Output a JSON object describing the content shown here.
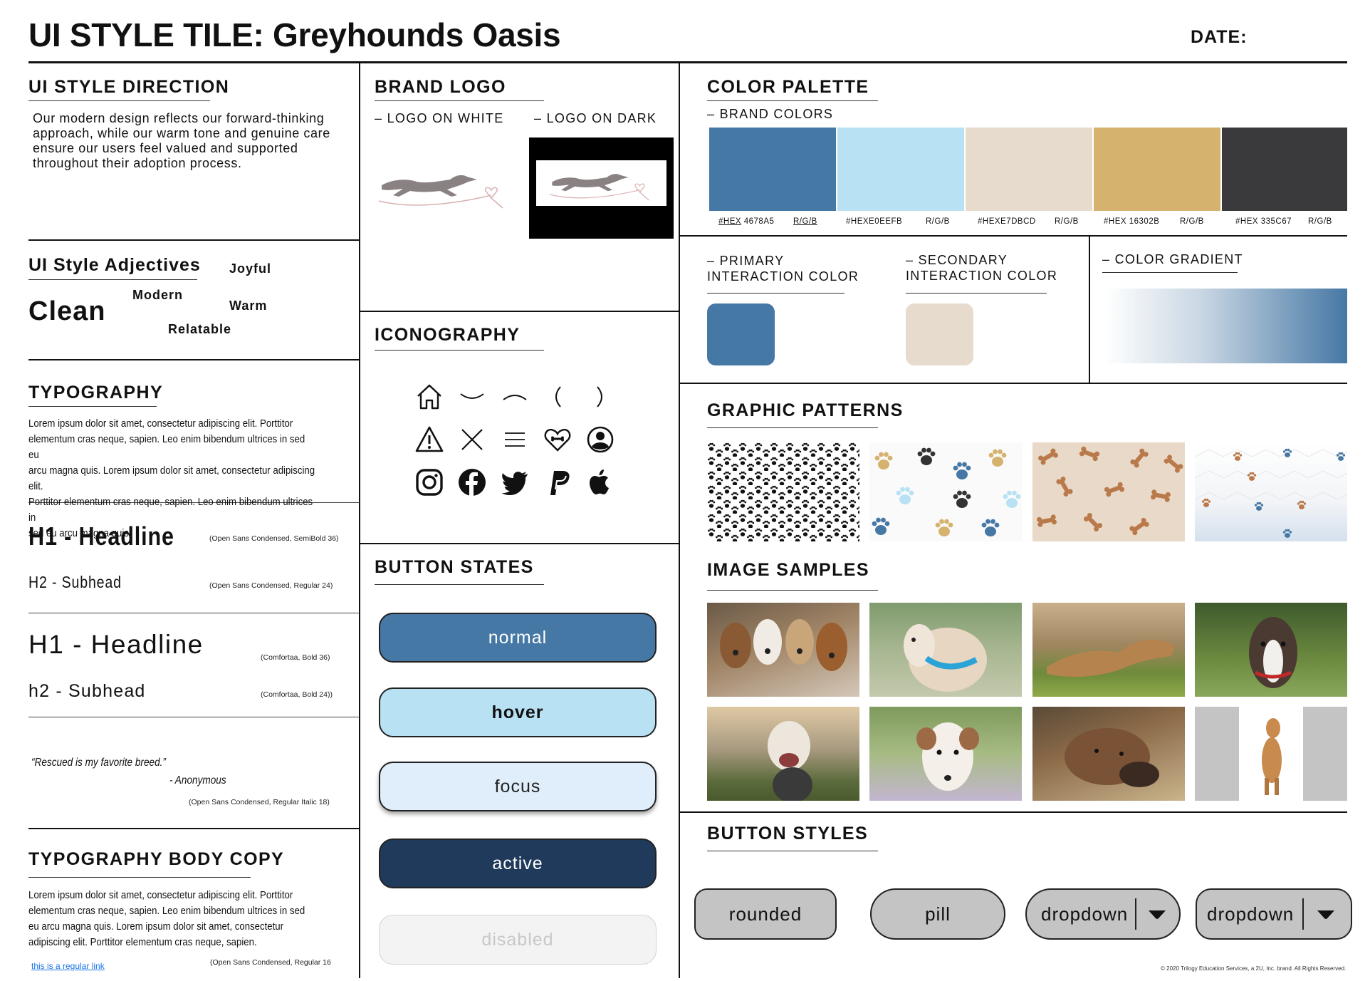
{
  "header": {
    "title": "UI STYLE TILE: Greyhounds Oasis",
    "date_label": "DATE:"
  },
  "direction": {
    "heading": "UI STYLE DIRECTION",
    "text_lines": [
      "Our modern design reflects our forward-thinking",
      "approach, while our warm tone and genuine care",
      "ensure our users feel valued and supported",
      "throughout their adoption process."
    ]
  },
  "adjectives": {
    "heading": "UI Style Adjectives",
    "words": {
      "clean": "Clean",
      "modern": "Modern",
      "joyful": "Joyful",
      "warm": "Warm",
      "relatable": "Relatable"
    }
  },
  "typography": {
    "heading": "TYPOGRAPHY",
    "lorem_lines": [
      "Lorem ipsum dolor sit amet, consectetur adipiscing elit. Porttitor",
      "elementum cras neque, sapien. Leo enim bibendum ultrices in sed eu",
      "arcu magna quis. Lorem ipsum dolor sit amet, consectetur adipiscing elit.",
      "Porttitor elementum cras neque, sapien. Leo enim bibendum ultrices in",
      "sed eu arcu magna quis."
    ],
    "h1_a": "H1 - Headline",
    "h1_a_note": "(Open Sans Condensed, SemiBold 36)",
    "h2_a": "H2 - Subhead",
    "h2_a_note": "(Open Sans Condensed, Regular 24)",
    "h1_b": "H1 - Headline",
    "h1_b_note": "(Comfortaa, Bold 36)",
    "h2_b": "h2 - Subhead",
    "h2_b_note": "(Comfortaa, Bold 24))",
    "quote": "“Rescued is my favorite breed.”",
    "quote_author": "- Anonymous",
    "quote_note": "(Open Sans Condensed, Regular Italic 18)"
  },
  "body_copy": {
    "heading": "TYPOGRAPHY BODY COPY",
    "lines": [
      "Lorem ipsum dolor sit amet, consectetur adipiscing elit. Porttitor",
      "elementum cras neque, sapien. Leo enim bibendum ultrices in sed",
      "eu arcu magna quis. Lorem ipsum dolor sit amet, consectetur",
      "adipiscing elit. Porttitor elementum cras neque, sapien."
    ],
    "link": "this is a regular link",
    "note": "(Open Sans Condensed, Regular 16"
  },
  "logo": {
    "heading": "BRAND LOGO",
    "on_white": "– LOGO ON WHITE",
    "on_dark": "– LOGO ON DARK"
  },
  "iconography": {
    "heading": "ICONOGRAPHY",
    "icons": [
      "home-icon",
      "chevron-down-icon",
      "chevron-up-icon",
      "chevron-left-icon",
      "chevron-right-icon",
      "warning-icon",
      "close-icon",
      "menu-icon",
      "heart-bone-icon",
      "user-icon",
      "instagram-icon",
      "facebook-icon",
      "twitter-icon",
      "paypal-icon",
      "apple-icon"
    ]
  },
  "button_states": {
    "heading": "BUTTON STATES",
    "normal": "normal",
    "hover": "hover",
    "focus": "focus",
    "active": "active",
    "disabled": "disabled"
  },
  "palette": {
    "heading": "COLOR PALETTE",
    "brand_label": "– BRAND COLORS",
    "swatches": [
      {
        "color": "#4678A5",
        "hex_text": "4678A5",
        "rgb": "R/G/B"
      },
      {
        "color": "#B8E1F3",
        "hex_text": "#HEXE0EEFB",
        "rgb": "R/G/B"
      },
      {
        "color": "#E7DBCD",
        "hex_text": "#HEXE7DBCD",
        "rgb": "R/G/B"
      },
      {
        "color": "#D6B26F",
        "hex_text": "#HEX 16302B",
        "rgb": "R/G/B"
      },
      {
        "color": "#3A3A3C",
        "hex_text": "#HEX 335C67",
        "rgb": "R/G/B"
      }
    ],
    "first_hex_prefix": "#HEX",
    "primary_label_1": "– PRIMARY",
    "primary_label_2": "INTERACTION COLOR",
    "secondary_label_1": "– SECONDARY",
    "secondary_label_2": "INTERACTION COLOR",
    "gradient_label": "– COLOR GRADIENT",
    "primary_color": "#4678A5",
    "secondary_color": "#E7DBCD"
  },
  "patterns": {
    "heading": "GRAPHIC PATTERNS"
  },
  "images": {
    "heading": "IMAGE SAMPLES"
  },
  "button_styles": {
    "heading": "BUTTON STYLES",
    "rounded": "rounded",
    "pill": "pill",
    "dropdown1": "dropdown",
    "dropdown2": "dropdown"
  },
  "footer": {
    "copyright": "© 2020 Trilogy Education Services, a 2U, Inc. brand. All Rights Reserved."
  }
}
